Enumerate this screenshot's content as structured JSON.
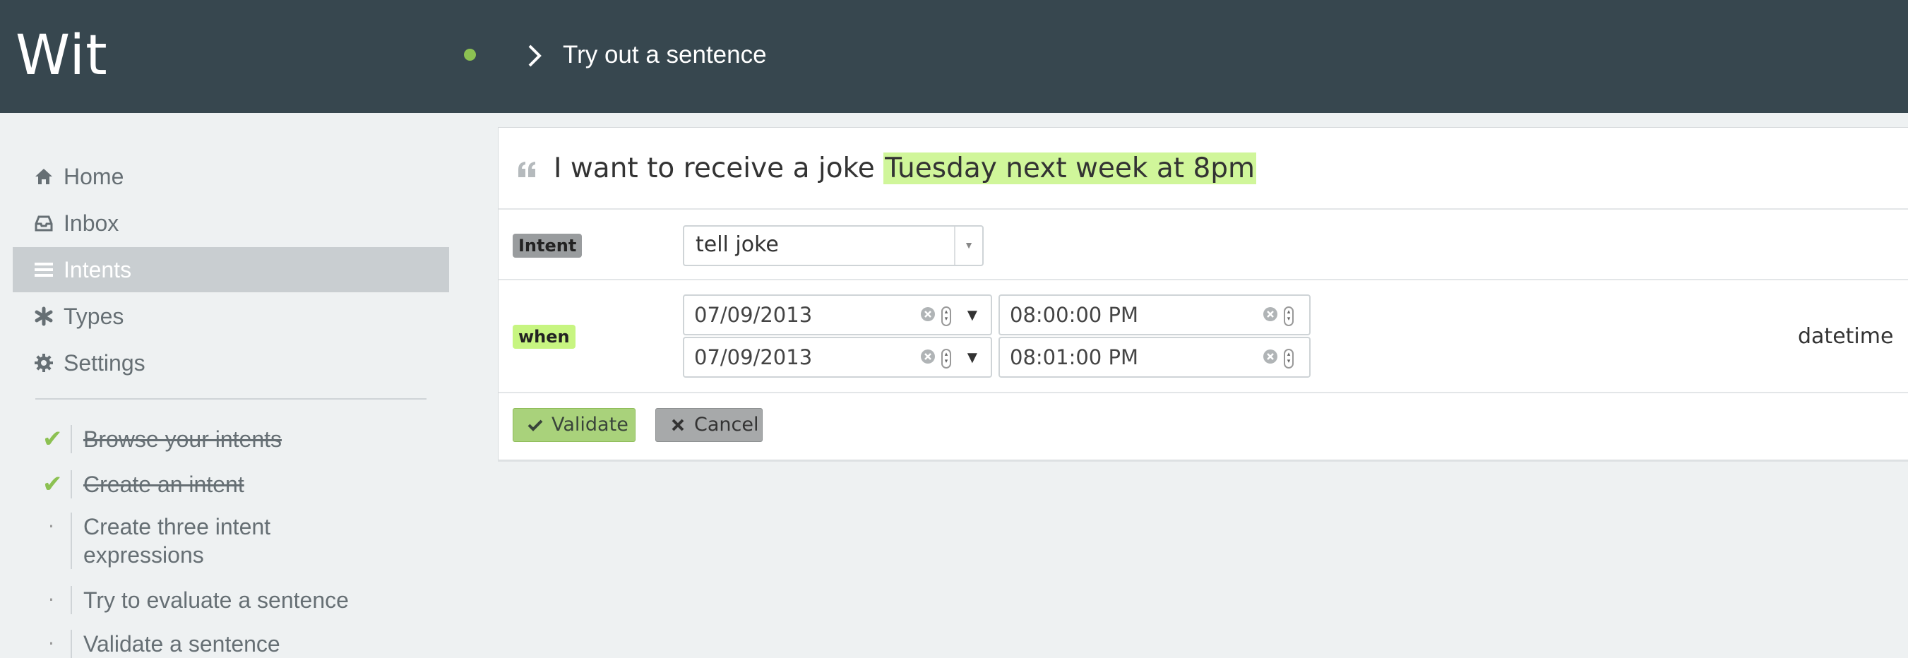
{
  "header": {
    "brand": "Wit",
    "title": "Try out a sentence",
    "status_color": "#8cc152"
  },
  "sidebar": {
    "items": [
      {
        "label": "Home",
        "icon": "home-icon"
      },
      {
        "label": "Inbox",
        "icon": "inbox-icon"
      },
      {
        "label": "Intents",
        "icon": "list-icon",
        "active": true
      },
      {
        "label": "Types",
        "icon": "asterisk-icon"
      },
      {
        "label": "Settings",
        "icon": "gear-icon"
      }
    ],
    "tasks": [
      {
        "label": "Browse your intents",
        "done": true
      },
      {
        "label": "Create an intent",
        "done": true
      },
      {
        "label": "Create three intent expressions",
        "done": false
      },
      {
        "label": "Try to evaluate a sentence",
        "done": false
      },
      {
        "label": "Validate a sentence",
        "done": false
      }
    ]
  },
  "sentence": {
    "plain": "I want to receive a joke ",
    "highlighted": "Tuesday next week at 8pm",
    "highlight_color": "#d0f69a"
  },
  "intent_row": {
    "badge": "Intent",
    "value": "tell joke"
  },
  "when_row": {
    "badge": "when",
    "from_date": "07/09/2013",
    "from_time": "08:00:00 PM",
    "to_date": "07/09/2013",
    "to_time": "08:01:00 PM",
    "type": "datetime"
  },
  "actions": {
    "validate_label": "Validate",
    "cancel_label": "Cancel"
  }
}
